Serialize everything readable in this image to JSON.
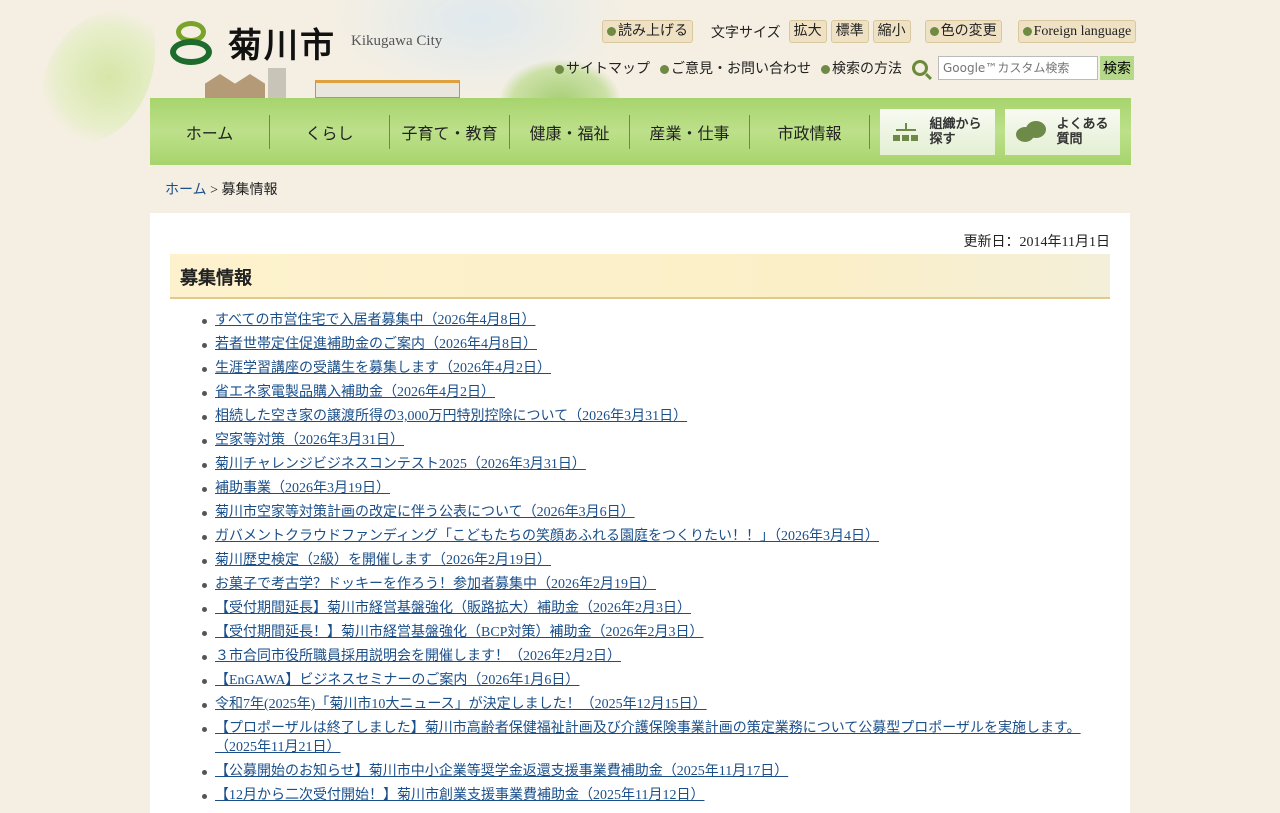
{
  "header": {
    "logo_text": "菊川市",
    "logo_en": "Kikugawa City"
  },
  "util": {
    "read_aloud": "読み上げる",
    "font_size_label": "文字サイズ",
    "font_large": "拡大",
    "font_normal": "標準",
    "font_small": "縮小",
    "color_change": "色の変更",
    "foreign": "Foreign language"
  },
  "links": {
    "sitemap": "サイトマップ",
    "contact": "ご意見・お問い合わせ",
    "search_help": "検索の方法"
  },
  "search": {
    "placeholder": "Google™カスタム検索",
    "button": "検索"
  },
  "nav": {
    "items": [
      "ホーム",
      "くらし",
      "子育て・教育",
      "健康・福祉",
      "産業・仕事",
      "市政情報"
    ],
    "org": [
      "組織から",
      "探す"
    ],
    "faq": [
      "よくある",
      "質問"
    ]
  },
  "breadcrumb": {
    "home": "ホーム",
    "sep": " > ",
    "current": "募集情報"
  },
  "page": {
    "updated": "更新日：2014年11月1日",
    "title": "募集情報"
  },
  "items": [
    "すべての市営住宅で入居者募集中（2026年4月8日）",
    "若者世帯定住促進補助金のご案内（2026年4月8日）",
    "生涯学習講座の受講生を募集します（2026年4月2日）",
    "省エネ家電製品購入補助金（2026年4月2日）",
    "相続した空き家の譲渡所得の3,000万円特別控除について（2026年3月31日）",
    "空家等対策（2026年3月31日）",
    "菊川チャレンジビジネスコンテスト2025（2026年3月31日）",
    "補助事業（2026年3月19日）",
    "菊川市空家等対策計画の改定に伴う公表について（2026年3月6日）",
    "ガバメントクラウドファンディング「こどもたちの笑顔あふれる園庭をつくりたい！！」（2026年3月4日）",
    "菊川歴史検定（2級）を開催します（2026年2月19日）",
    "お菓子で考古学？ドッキーを作ろう！参加者募集中（2026年2月19日）",
    "【受付期間延長】菊川市経営基盤強化（販路拡大）補助金（2026年2月3日）",
    "【受付期間延長！】菊川市経営基盤強化（BCP対策）補助金（2026年2月3日）",
    "３市合同市役所職員採用説明会を開催します！（2026年2月2日）",
    "【EnGAWA】ビジネスセミナーのご案内（2026年1月6日）",
    "令和7年(2025年)「菊川市10大ニュース」が決定しました！（2025年12月15日）",
    "【プロポーザルは終了しました】菊川市高齢者保健福祉計画及び介護保険事業計画の策定業務について公募型プロポーザルを実施します。（2025年11月21日）",
    "【公募開始のお知らせ】菊川市中小企業等奨学金返還支援事業費補助金（2025年11月17日）",
    "【12月から二次受付開始！】菊川市創業支援事業費補助金（2025年11月12日）"
  ]
}
